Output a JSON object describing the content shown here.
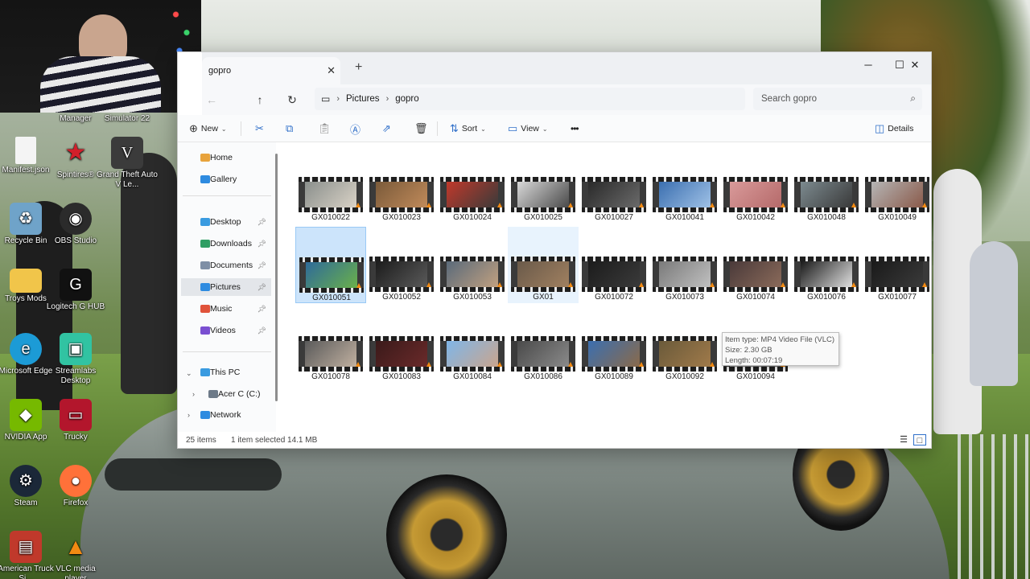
{
  "window": {
    "tab_title": "gopro",
    "tab_close": "✕",
    "new_tab": "+",
    "controls": {
      "minimize": "─",
      "maximize": "☐",
      "close": "✕"
    }
  },
  "address": {
    "back": "←",
    "forward": "→",
    "up": "↑",
    "refresh": "↻",
    "path": [
      "Pictures",
      "gopro"
    ],
    "search_placeholder": "Search gopro"
  },
  "toolbar": {
    "new": "New",
    "sort": "Sort",
    "view": "View",
    "more": "•••",
    "details": "Details"
  },
  "sidebar": {
    "home": "Home",
    "gallery": "Gallery",
    "desktop": "Desktop",
    "downloads": "Downloads",
    "documents": "Documents",
    "pictures": "Pictures",
    "music": "Music",
    "videos": "Videos",
    "this_pc": "This PC",
    "acer": "Acer C (C:)",
    "network": "Network"
  },
  "files": [
    "GX010022",
    "GX010023",
    "GX010024",
    "GX010025",
    "GX010027",
    "GX010041",
    "GX010042",
    "GX010048",
    "GX010049",
    "GX010051",
    "GX010052",
    "GX010053",
    "GX01",
    "GX010072",
    "GX010073",
    "GX010074",
    "GX010076",
    "GX010077",
    "GX010078",
    "GX010083",
    "GX010084",
    "GX010086",
    "GX010089",
    "GX010092",
    "GX010094"
  ],
  "tooltip": {
    "type": "Item type: MP4 Video File (VLC)",
    "size": "Size: 2.30 GB",
    "length": "Length: 00:07:19"
  },
  "status": {
    "count": "25 items",
    "selected": "1 item selected  14.1 MB"
  },
  "desktop_icons": [
    "Manager",
    "Simulator 22",
    "Manifest.json",
    "Spintires®",
    "Grand Theft Auto V Le...",
    "Recycle Bin",
    "OBS Studio",
    "Troys Mods",
    "Logitech G HUB",
    "Microsoft Edge",
    "Streamlabs Desktop",
    "NVIDIA App",
    "Trucky",
    "Steam",
    "Firefox",
    "American Truck Si...",
    "VLC media player"
  ]
}
